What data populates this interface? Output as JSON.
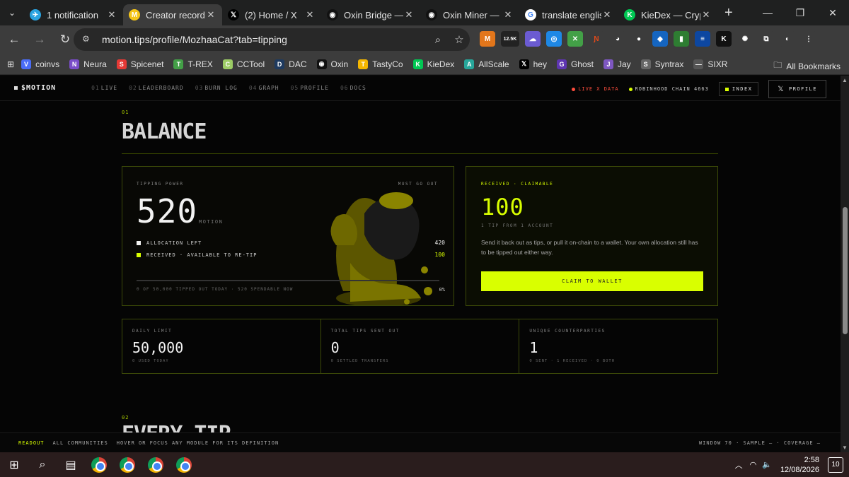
{
  "browser": {
    "tabs": [
      {
        "title": "1 notification",
        "icon": "telegram-icon",
        "color": "#2aa3e0",
        "glyph": "✈"
      },
      {
        "title": "Creator record",
        "icon": "motion-m-icon",
        "color": "#f5c518",
        "glyph": "M",
        "active": true
      },
      {
        "title": "(2) Home / X",
        "icon": "x-icon",
        "color": "#000000",
        "glyph": "𝕏"
      },
      {
        "title": "Oxin Bridge — P",
        "icon": "oxin-icon",
        "color": "#111111",
        "glyph": "◉"
      },
      {
        "title": "Oxin Miner — M",
        "icon": "oxin-icon",
        "color": "#111111",
        "glyph": "◉"
      },
      {
        "title": "translate english",
        "icon": "google-icon",
        "color": "#ffffff",
        "glyph": "G"
      },
      {
        "title": "KieDex — Crypt",
        "icon": "kiedex-icon",
        "color": "#00c853",
        "glyph": "K"
      }
    ],
    "url": "motion.tips/profile/MozhaaCat?tab=tipping",
    "extension_badge": "12.5K",
    "bookmarks": [
      {
        "label": "coinvs",
        "color": "#4a6cf7",
        "glyph": "V"
      },
      {
        "label": "Neura",
        "color": "#7a4cc9",
        "glyph": "N"
      },
      {
        "label": "Spicenet",
        "color": "#e53935",
        "glyph": "S"
      },
      {
        "label": "T-REX",
        "color": "#43a047",
        "glyph": "T"
      },
      {
        "label": "CCTool",
        "color": "#9ccc65",
        "glyph": "C"
      },
      {
        "label": "DAC",
        "color": "#1e3a5f",
        "glyph": "D"
      },
      {
        "label": "Oxin",
        "color": "#111111",
        "glyph": "◉"
      },
      {
        "label": "TastyCo",
        "color": "#f5b700",
        "glyph": "T"
      },
      {
        "label": "KieDex",
        "color": "#00c853",
        "glyph": "K"
      },
      {
        "label": "AllScale",
        "color": "#26a69a",
        "glyph": "A"
      },
      {
        "label": "hey",
        "color": "#000000",
        "glyph": "𝕏"
      },
      {
        "label": "Ghost",
        "color": "#5e35b1",
        "glyph": "G"
      },
      {
        "label": "Jay",
        "color": "#7e57c2",
        "glyph": "J"
      },
      {
        "label": "Syntrax",
        "color": "#666666",
        "glyph": "S"
      },
      {
        "label": "SIXR",
        "color": "#555555",
        "glyph": "—"
      }
    ],
    "all_bookmarks": "All Bookmarks"
  },
  "site": {
    "logo": "$MOTION",
    "nav": [
      {
        "num": "01",
        "label": "LIVE"
      },
      {
        "num": "02",
        "label": "LEADERBOARD"
      },
      {
        "num": "03",
        "label": "BURN LOG"
      },
      {
        "num": "04",
        "label": "GRAPH"
      },
      {
        "num": "05",
        "label": "PROFILE"
      },
      {
        "num": "06",
        "label": "DOCS"
      }
    ],
    "live": "LIVE X DATA",
    "chain": "ROBINHOOD CHAIN 4663",
    "index_button": "INDEX",
    "profile_button": "PROFILE",
    "section1_num": "01",
    "section1_title": "BALANCE",
    "section2_num": "02",
    "section2_title": "EVERY TIP"
  },
  "tipping": {
    "label": "TIPPING POWER",
    "corner": "MUST GO OUT",
    "value": "520",
    "unit": "MOTION",
    "allocation_label": "ALLOCATION LEFT",
    "allocation_value": "420",
    "received_label": "RECEIVED · AVAILABLE TO RE-TIP",
    "received_value": "100",
    "progress_fraction": 0,
    "footer": "0 OF 50,000 TIPPED OUT TODAY · 520 SPENDABLE NOW",
    "percent": "0%"
  },
  "received": {
    "label": "RECEIVED · CLAIMABLE",
    "value": "100",
    "sub": "1 TIP FROM 1 ACCOUNT",
    "description": "Send it back out as tips, or pull it on-chain to a wallet. Your own allocation still has to be tipped out either way.",
    "button": "CLAIM TO WALLET"
  },
  "stats": [
    {
      "label": "DAILY LIMIT",
      "value": "50,000",
      "sub": "0 USED TODAY"
    },
    {
      "label": "TOTAL TIPS SENT OUT",
      "value": "0",
      "sub": "0 SETTLED TRANSFERS"
    },
    {
      "label": "UNIQUE COUNTERPARTIES",
      "value": "1",
      "sub": "0 SENT · 1 RECEIVED · 0 BOTH"
    }
  ],
  "readout": {
    "label": "READOUT",
    "scope": "ALL COMMUNITIES",
    "hint": "HOVER OR FOCUS ANY MODULE FOR ITS DEFINITION",
    "right": "WINDOW 70 · SAMPLE — · COVERAGE —"
  },
  "taskbar": {
    "time": "2:58",
    "date": "12/08/2026",
    "notifications": "10"
  },
  "colors": {
    "accent": "#d9ff00",
    "live": "#ff4d3d"
  }
}
